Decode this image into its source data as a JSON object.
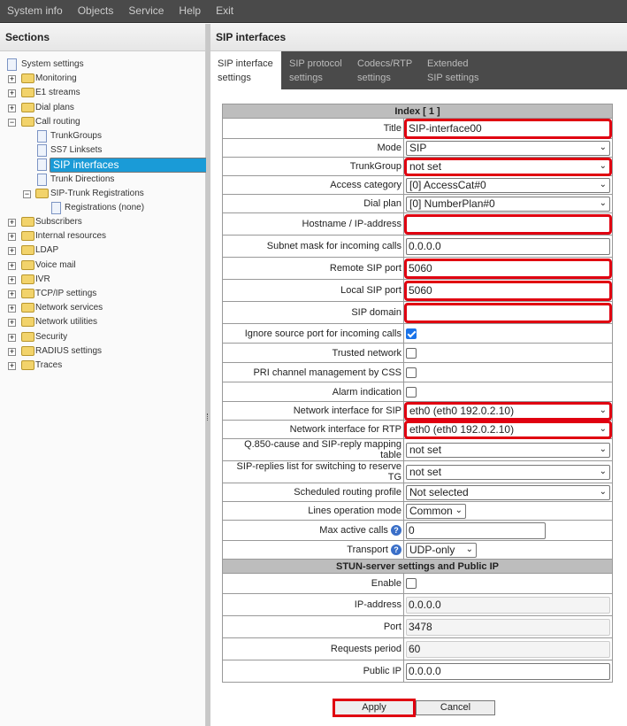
{
  "menu": [
    "System info",
    "Objects",
    "Service",
    "Help",
    "Exit"
  ],
  "sidebar": {
    "title": "Sections",
    "items": [
      {
        "label": "System settings",
        "type": "doc",
        "depth": 0
      },
      {
        "label": "Monitoring",
        "type": "folder",
        "depth": 0,
        "exp": "+"
      },
      {
        "label": "E1 streams",
        "type": "folder",
        "depth": 0,
        "exp": "+"
      },
      {
        "label": "Dial plans",
        "type": "folder",
        "depth": 0,
        "exp": "+"
      },
      {
        "label": "Call routing",
        "type": "folder",
        "depth": 0,
        "exp": "-"
      },
      {
        "label": "TrunkGroups",
        "type": "doc",
        "depth": 1
      },
      {
        "label": "SS7 Linksets",
        "type": "doc",
        "depth": 1
      },
      {
        "label": "SIP interfaces",
        "type": "doc",
        "depth": 1,
        "selected": true
      },
      {
        "label": "Trunk Directions",
        "type": "doc",
        "depth": 1
      },
      {
        "label": "SIP-Trunk Registrations",
        "type": "folder",
        "depth": 1,
        "exp": "-"
      },
      {
        "label": "Registrations (none)",
        "type": "doc",
        "depth": 2
      },
      {
        "label": "Subscribers",
        "type": "folder",
        "depth": 0,
        "exp": "+"
      },
      {
        "label": "Internal resources",
        "type": "folder",
        "depth": 0,
        "exp": "+"
      },
      {
        "label": "LDAP",
        "type": "folder",
        "depth": 0,
        "exp": "+"
      },
      {
        "label": "Voice mail",
        "type": "folder",
        "depth": 0,
        "exp": "+"
      },
      {
        "label": "IVR",
        "type": "folder",
        "depth": 0,
        "exp": "+"
      },
      {
        "label": "TCP/IP settings",
        "type": "folder",
        "depth": 0,
        "exp": "+"
      },
      {
        "label": "Network services",
        "type": "folder",
        "depth": 0,
        "exp": "+"
      },
      {
        "label": "Network utilities",
        "type": "folder",
        "depth": 0,
        "exp": "+"
      },
      {
        "label": "Security",
        "type": "folder",
        "depth": 0,
        "exp": "+"
      },
      {
        "label": "RADIUS settings",
        "type": "folder",
        "depth": 0,
        "exp": "+"
      },
      {
        "label": "Traces",
        "type": "folder",
        "depth": 0,
        "exp": "+"
      }
    ]
  },
  "main": {
    "title": "SIP interfaces",
    "tabs": [
      "SIP interface settings",
      "SIP protocol settings",
      "Codecs/RTP settings",
      "Extended SIP settings"
    ],
    "rows": [
      {
        "type": "header",
        "label": "Index [ 1 ]"
      },
      {
        "label": "Title",
        "type": "text",
        "value": "SIP-interface00",
        "req": true
      },
      {
        "label": "Mode",
        "type": "select",
        "value": "SIP"
      },
      {
        "label": "TrunkGroup",
        "type": "select",
        "value": "not set",
        "req": true
      },
      {
        "label": "Access category",
        "type": "select",
        "value": "[0] AccessCat#0"
      },
      {
        "label": "Dial plan",
        "type": "select",
        "value": "[0] NumberPlan#0"
      },
      {
        "label": "Hostname / IP-address",
        "type": "text",
        "value": "",
        "req": true
      },
      {
        "label": "Subnet mask for incoming calls",
        "type": "text",
        "value": "0.0.0.0"
      },
      {
        "label": "Remote SIP port",
        "type": "text",
        "value": "5060",
        "req": true
      },
      {
        "label": "Local SIP port",
        "type": "text",
        "value": "5060",
        "req": true
      },
      {
        "label": "SIP domain",
        "type": "text",
        "value": "",
        "req": true
      },
      {
        "label": "Ignore source port for incoming calls",
        "type": "check",
        "checked": true
      },
      {
        "label": "Trusted network",
        "type": "check",
        "checked": false
      },
      {
        "label": "PRI channel management by CSS",
        "type": "check",
        "checked": false
      },
      {
        "label": "Alarm indication",
        "type": "check",
        "checked": false
      },
      {
        "label": "Network interface for SIP",
        "type": "select",
        "value": "eth0 (eth0 192.0.2.10)",
        "req": true
      },
      {
        "label": "Network interface for RTP",
        "type": "select",
        "value": "eth0 (eth0 192.0.2.10)",
        "req": true
      },
      {
        "label": "Q.850-cause and SIP-reply mapping table",
        "type": "select",
        "value": "not set"
      },
      {
        "label": "SIP-replies list for switching to reserve TG",
        "type": "select",
        "value": "not set"
      },
      {
        "label": "Scheduled routing profile",
        "type": "select",
        "value": "Not selected"
      },
      {
        "label": "Lines operation mode",
        "type": "select",
        "value": "Common",
        "narrow": "68px"
      },
      {
        "label": "Max active calls",
        "type": "text",
        "value": "0",
        "help": true,
        "narrow": "158px"
      },
      {
        "label": "Transport",
        "type": "select",
        "value": "UDP-only",
        "help": true,
        "narrow": "80px"
      },
      {
        "type": "header",
        "label": "STUN-server settings and Public IP"
      },
      {
        "label": "Enable",
        "type": "check",
        "checked": false
      },
      {
        "label": "IP-address",
        "type": "text",
        "value": "0.0.0.0",
        "disabled": true
      },
      {
        "label": "Port",
        "type": "text",
        "value": "3478",
        "disabled": true
      },
      {
        "label": "Requests period",
        "type": "text",
        "value": "60",
        "disabled": true
      },
      {
        "label": "Public IP",
        "type": "text",
        "value": "0.0.0.0"
      }
    ],
    "apply_label": "Apply",
    "cancel_label": "Cancel"
  }
}
